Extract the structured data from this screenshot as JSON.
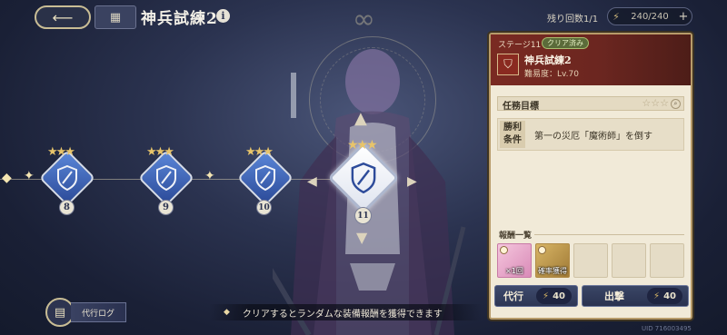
{
  "header": {
    "title": "神兵試練2",
    "info_icon": "i",
    "remaining_label": "残り回数1/1",
    "stamina_value": "240/240",
    "stamina_plus": "+"
  },
  "stages": [
    {
      "number": "8",
      "stars": 3,
      "selected": false
    },
    {
      "number": "9",
      "stars": 3,
      "selected": false
    },
    {
      "number": "10",
      "stars": 3,
      "selected": false
    },
    {
      "number": "11",
      "stars": 3,
      "selected": true
    }
  ],
  "panel": {
    "stage_label": "ステージ11",
    "clear_badge": "クリア済み",
    "stage_name": "神兵試練2",
    "difficulty": "難易度：Lv.70",
    "mission_title": "任務目標",
    "mission_stars": "☆☆☆",
    "condition_label": "勝利条件",
    "condition_text": "第一の災厄「魔術師」を倒す",
    "rewards_title": "報酬一覧",
    "rewards": [
      {
        "label": "×1回",
        "style": "pink"
      },
      {
        "label": "確率獲得",
        "style": "gold"
      },
      {
        "label": "",
        "style": "empty"
      },
      {
        "label": "",
        "style": "empty"
      },
      {
        "label": "",
        "style": "empty"
      }
    ],
    "delegate_label": "代行",
    "delegate_cost": "40",
    "attack_label": "出撃",
    "attack_cost": "40"
  },
  "bottom": {
    "log_label": "代行ログ",
    "hint_text": "クリアするとランダムな装備報酬を獲得できます"
  },
  "uid": "UID 716003495",
  "colors": {
    "accent_gold": "#e8c46a",
    "panel_header": "#7a2a22",
    "node_blue": "#3b62b8",
    "clear_green": "#5b6b3a"
  }
}
